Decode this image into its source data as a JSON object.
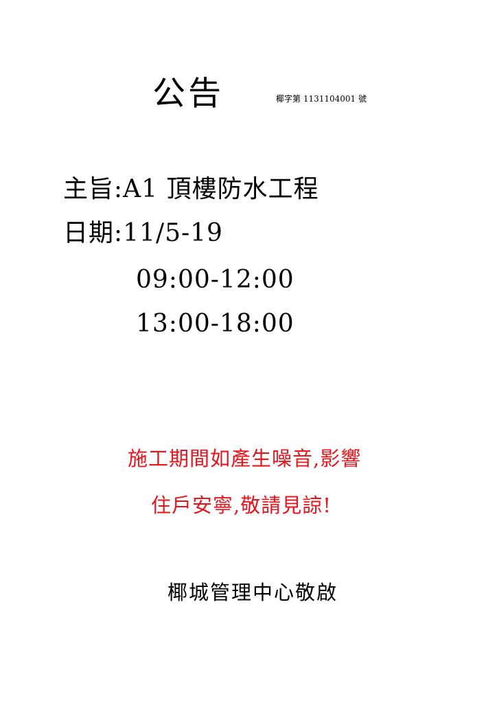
{
  "notice": {
    "title": "公告",
    "ref_number": "椰字第 1131104001 號",
    "subject": "主旨:A1 頂樓防水工程",
    "date": "日期:11/5-19",
    "times": [
      "09:00-12:00",
      "13:00-18:00"
    ],
    "apology_lines": [
      "施工期間如產生噪音,影響",
      "住戶安寧,敬請見諒!"
    ],
    "signature": "椰城管理中心敬啟"
  },
  "colors": {
    "text": "#000000",
    "apology": "#e8141b",
    "background": "#ffffff"
  }
}
